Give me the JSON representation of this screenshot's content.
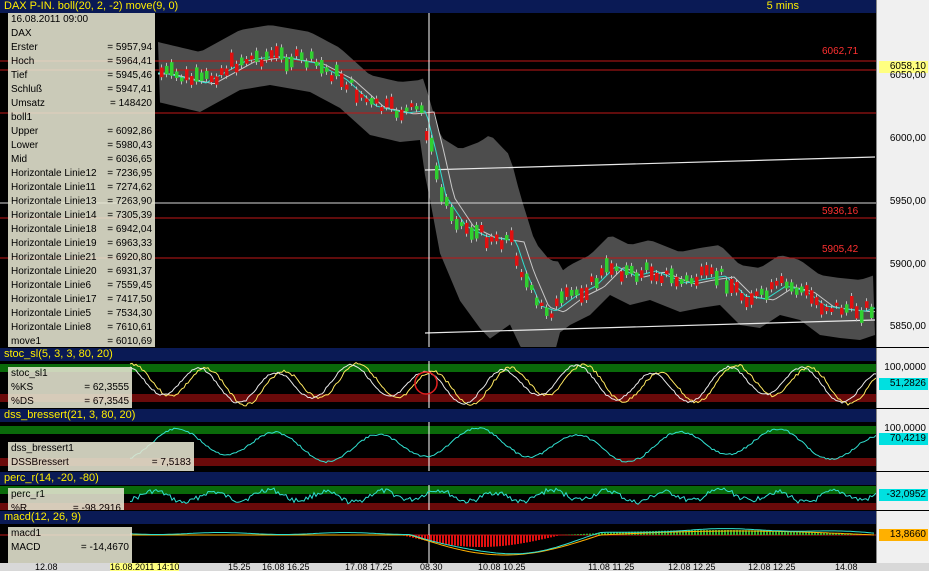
{
  "main": {
    "header": "DAX P-IN. boll(20, 2, -2) move(9, 0)",
    "timeframe": "5 mins",
    "axis_ticks": [
      "6050,00",
      "6000,00",
      "5950,00",
      "5900,00",
      "5850,00"
    ],
    "price_badge": "6058,10",
    "hlines": [
      {
        "label": "6062,71"
      },
      {
        "label": "5936,16"
      },
      {
        "label": "5905,42"
      }
    ],
    "info": [
      {
        "k": "16.08.2011  09:00",
        "v": ""
      },
      {
        "k": "DAX",
        "v": ""
      },
      {
        "k": "Erster",
        "v": "= 5957,94"
      },
      {
        "k": "Hoch",
        "v": "= 5964,41"
      },
      {
        "k": "Tief",
        "v": "= 5945,46"
      },
      {
        "k": "Schluß",
        "v": "= 5947,41"
      },
      {
        "k": "Umsatz",
        "v": "= 148420"
      },
      {
        "k": "boll1",
        "v": ""
      },
      {
        "k": "Upper",
        "v": "= 6092,86"
      },
      {
        "k": "Lower",
        "v": "= 5980,43"
      },
      {
        "k": "Mid",
        "v": "= 6036,65"
      },
      {
        "k": "Horizontale Linie12",
        "v": "= 7236,95"
      },
      {
        "k": "Horizontale Linie11",
        "v": "= 7274,62"
      },
      {
        "k": "Horizontale Linie13",
        "v": "= 7263,90"
      },
      {
        "k": "Horizontale Linie14",
        "v": "= 7305,39"
      },
      {
        "k": "Horizontale Linie18",
        "v": "= 6942,04"
      },
      {
        "k": "Horizontale Linie19",
        "v": "= 6963,33"
      },
      {
        "k": "Horizontale Linie21",
        "v": "= 6920,80"
      },
      {
        "k": "Horizontale Linie20",
        "v": "= 6931,37"
      },
      {
        "k": "Horizontale Linie6",
        "v": "= 7559,45"
      },
      {
        "k": "Horizontale Linie17",
        "v": "= 7417,50"
      },
      {
        "k": "Horizontale Linie5",
        "v": "= 7534,30"
      },
      {
        "k": "Horizontale Linie8",
        "v": "= 7610,61"
      },
      {
        "k": "move1",
        "v": "= 6010,69"
      }
    ]
  },
  "stoc": {
    "header": "stoc_sl(5, 3, 3, 80, 20)",
    "axis_top": "100,0000",
    "badge": "51,2826",
    "badge_color": "#00e0e0",
    "info": [
      {
        "k": "stoc_sl1",
        "v": ""
      },
      {
        "k": "%KS",
        "v": "= 62,3555"
      },
      {
        "k": "%DS",
        "v": "= 67,3545"
      }
    ]
  },
  "dss": {
    "header": "dss_bressert(21, 3, 80, 20)",
    "axis_top": "100,0000",
    "badge": "70,4219",
    "badge_color": "#00e0e0",
    "info": [
      {
        "k": "dss_bressert1",
        "v": ""
      },
      {
        "k": "DSSBressert",
        "v": "= 7,5183"
      }
    ]
  },
  "perc": {
    "header": "perc_r(14, -20, -80)",
    "badge": "-32,0952",
    "badge_color": "#00e0e0",
    "info": [
      {
        "k": "perc_r1",
        "v": ""
      },
      {
        "k": "%R",
        "v": "= -98,2916"
      }
    ]
  },
  "macd": {
    "header": "macd(12, 26, 9)",
    "badge": "13,8660",
    "badge_color": "#ffb000",
    "info": [
      {
        "k": "macd1",
        "v": ""
      },
      {
        "k": "MACD",
        "v": "= -14,4670"
      }
    ]
  },
  "time_axis": [
    "12.08",
    "16.08.2011 14:10",
    "15.25",
    "16.08 16.25",
    "17.08 17.25",
    "08.30",
    "10.08 10.25",
    "11.08 11.25",
    "12.08 12.25",
    "12.08 12.25",
    "14.08"
  ],
  "colors": {
    "bull": "#30d030",
    "bear": "#e01010",
    "band": "#5a5a5a",
    "hline": "#c01818",
    "header_bg": "#0a1a55",
    "header_fg": "#ffee00"
  }
}
